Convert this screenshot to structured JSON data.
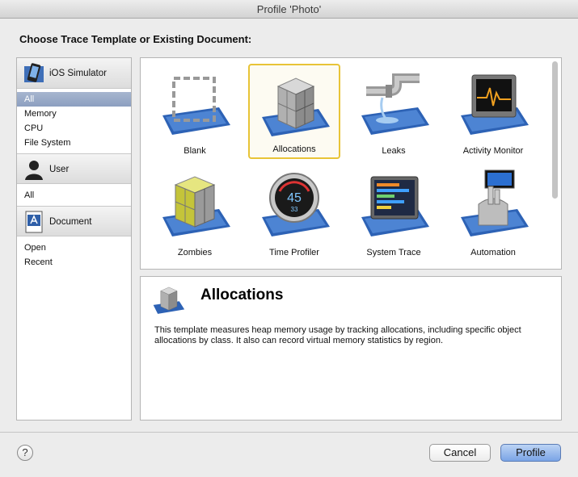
{
  "window": {
    "title": "Profile 'Photo'"
  },
  "heading": "Choose Trace Template or Existing Document:",
  "sidebar": {
    "groups": [
      {
        "label": "iOS Simulator",
        "icon": "ios-simulator-icon",
        "items": [
          "All",
          "Memory",
          "CPU",
          "File System"
        ],
        "selected": "All"
      },
      {
        "label": "User",
        "icon": "user-icon",
        "items": [
          "All"
        ]
      },
      {
        "label": "Document",
        "icon": "document-icon",
        "items": [
          "Open",
          "Recent"
        ]
      }
    ]
  },
  "templates": [
    {
      "label": "Blank",
      "icon": "blank-template-icon"
    },
    {
      "label": "Allocations",
      "icon": "allocations-cubes-icon",
      "selected": true
    },
    {
      "label": "Leaks",
      "icon": "leaking-pipe-icon"
    },
    {
      "label": "Activity Monitor",
      "icon": "activity-monitor-icon"
    },
    {
      "label": "Zombies",
      "icon": "zombies-cubes-icon"
    },
    {
      "label": "Time Profiler",
      "icon": "time-profiler-gauge-icon",
      "gauge_value": "45",
      "gauge_sub": "33"
    },
    {
      "label": "System Trace",
      "icon": "system-trace-icon"
    },
    {
      "label": "Automation",
      "icon": "automation-robot-icon"
    }
  ],
  "detail": {
    "title": "Allocations",
    "description": "This template measures heap memory usage by tracking allocations, including specific object allocations by class. It also can record virtual memory statistics by region."
  },
  "buttons": {
    "help": "?",
    "cancel": "Cancel",
    "profile": "Profile"
  },
  "colors": {
    "selection_border": "#e8c437",
    "sidebar_selection": "#8c9fc0",
    "default_button": "#7aa4e6"
  }
}
